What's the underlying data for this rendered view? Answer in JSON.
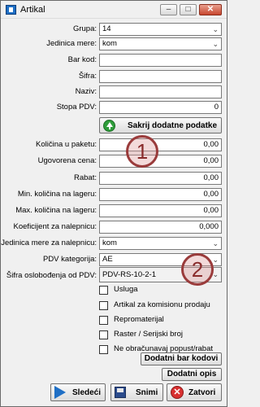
{
  "window": {
    "title": "Artikal"
  },
  "titlebar": {
    "min": "–",
    "max": "□",
    "close": "✕"
  },
  "form": {
    "grupa": {
      "label": "Grupa:",
      "value": "14"
    },
    "jedinica_mere": {
      "label": "Jedinica mere:",
      "value": "kom"
    },
    "bar_kod": {
      "label": "Bar kod:",
      "value": ""
    },
    "sifra": {
      "label": "Šifra:",
      "value": ""
    },
    "naziv": {
      "label": "Naziv:",
      "value": ""
    },
    "stopa_pdv": {
      "label": "Stopa PDV:",
      "value": "0"
    }
  },
  "toggle_button": {
    "label": "Sakrij dodatne podatke"
  },
  "extra": {
    "kolicina_u_paketu": {
      "label": "Količina u paketu:",
      "value": "0,00"
    },
    "ugovorena_cena": {
      "label": "Ugovorena cena:",
      "value": "0,00"
    },
    "rabat": {
      "label": "Rabat:",
      "value": "0,00"
    },
    "min_kolicina": {
      "label": "Min. količina na lageru:",
      "value": "0,00"
    },
    "max_kolicina": {
      "label": "Max. količina na lageru:",
      "value": "0,00"
    },
    "koeficijent": {
      "label": "Koeficijent za nalepnicu:",
      "value": "0,000"
    },
    "jedinica_nalepnica": {
      "label": "Jedinica mere za nalepnicu:",
      "value": "kom"
    },
    "pdv_kategorija": {
      "label": "PDV kategorija:",
      "value": "AE"
    },
    "sifra_oslobodjenja": {
      "label": "Šifra oslobođenja od PDV:",
      "value": "PDV-RS-10-2-1"
    }
  },
  "markers": {
    "one": "1",
    "two": "2"
  },
  "checkboxes": [
    {
      "label": "Usluga"
    },
    {
      "label": "Artikal za komisionu prodaju"
    },
    {
      "label": "Repromaterijal"
    },
    {
      "label": "Raster / Serijski broj"
    },
    {
      "label": "Ne obračunavaj popust/rabat"
    }
  ],
  "buttons": {
    "dodatni_bar_kodovi": "Dodatni bar kodovi",
    "dodatni_opis": "Dodatni opis",
    "sledeci": "Sledeći",
    "snimi": "Snimi",
    "zatvori": "Zatvori"
  },
  "icons": {
    "app": "app-icon",
    "toggle": "green-up-arrow-icon",
    "next": "blue-next-arrow-icon",
    "save": "floppy-disk-icon",
    "close": "red-x-icon"
  },
  "colors": {
    "marker": "#9a3b3b",
    "toggle_icon": "#2e9d3a",
    "next_icon": "#1f6fc5",
    "close_icon": "#d83030"
  }
}
